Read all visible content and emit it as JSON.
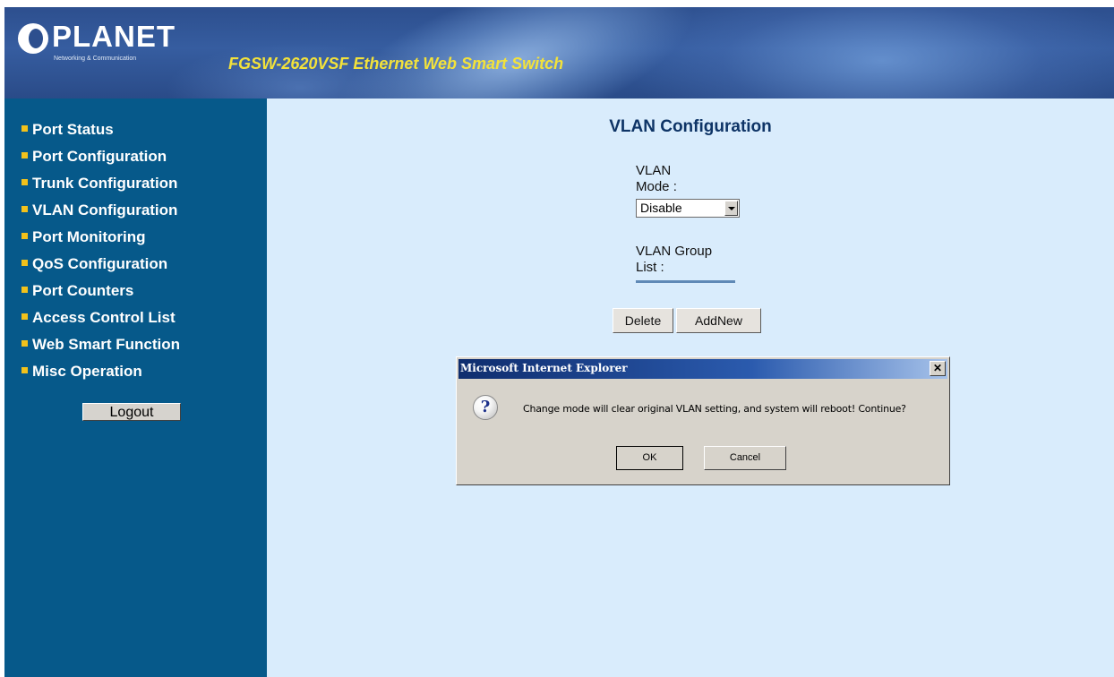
{
  "header": {
    "logo_text": "PLANET",
    "logo_subtitle": "Networking & Communication",
    "product_title": "FGSW-2620VSF Ethernet Web Smart Switch"
  },
  "sidebar": {
    "items": [
      {
        "label": "Port Status"
      },
      {
        "label": "Port Configuration"
      },
      {
        "label": "Trunk Configuration"
      },
      {
        "label": "VLAN Configuration"
      },
      {
        "label": "Port Monitoring"
      },
      {
        "label": "QoS Configuration"
      },
      {
        "label": "Port Counters"
      },
      {
        "label": "Access Control List"
      },
      {
        "label": "Web Smart Function"
      },
      {
        "label": "Misc Operation"
      }
    ],
    "logout_label": "Logout"
  },
  "main": {
    "title": "VLAN Configuration",
    "vlan_mode_label_line1": "VLAN",
    "vlan_mode_label_line2": "Mode :",
    "vlan_mode_value": "Disable",
    "group_label_line1": "VLAN Group",
    "group_label_line2": "List :",
    "delete_label": "Delete",
    "addnew_label": "AddNew"
  },
  "dialog": {
    "title": "Microsoft Internet Explorer",
    "close_glyph": "✕",
    "icon_glyph": "?",
    "message": "Change mode will clear original VLAN setting, and system will reboot! Continue?",
    "ok_label": "OK",
    "cancel_label": "Cancel"
  },
  "colors": {
    "sidebar_bg": "#06598a",
    "main_bg": "#d9ecfc",
    "header_title": "#f3e23a",
    "bullet": "#f2c21b"
  }
}
